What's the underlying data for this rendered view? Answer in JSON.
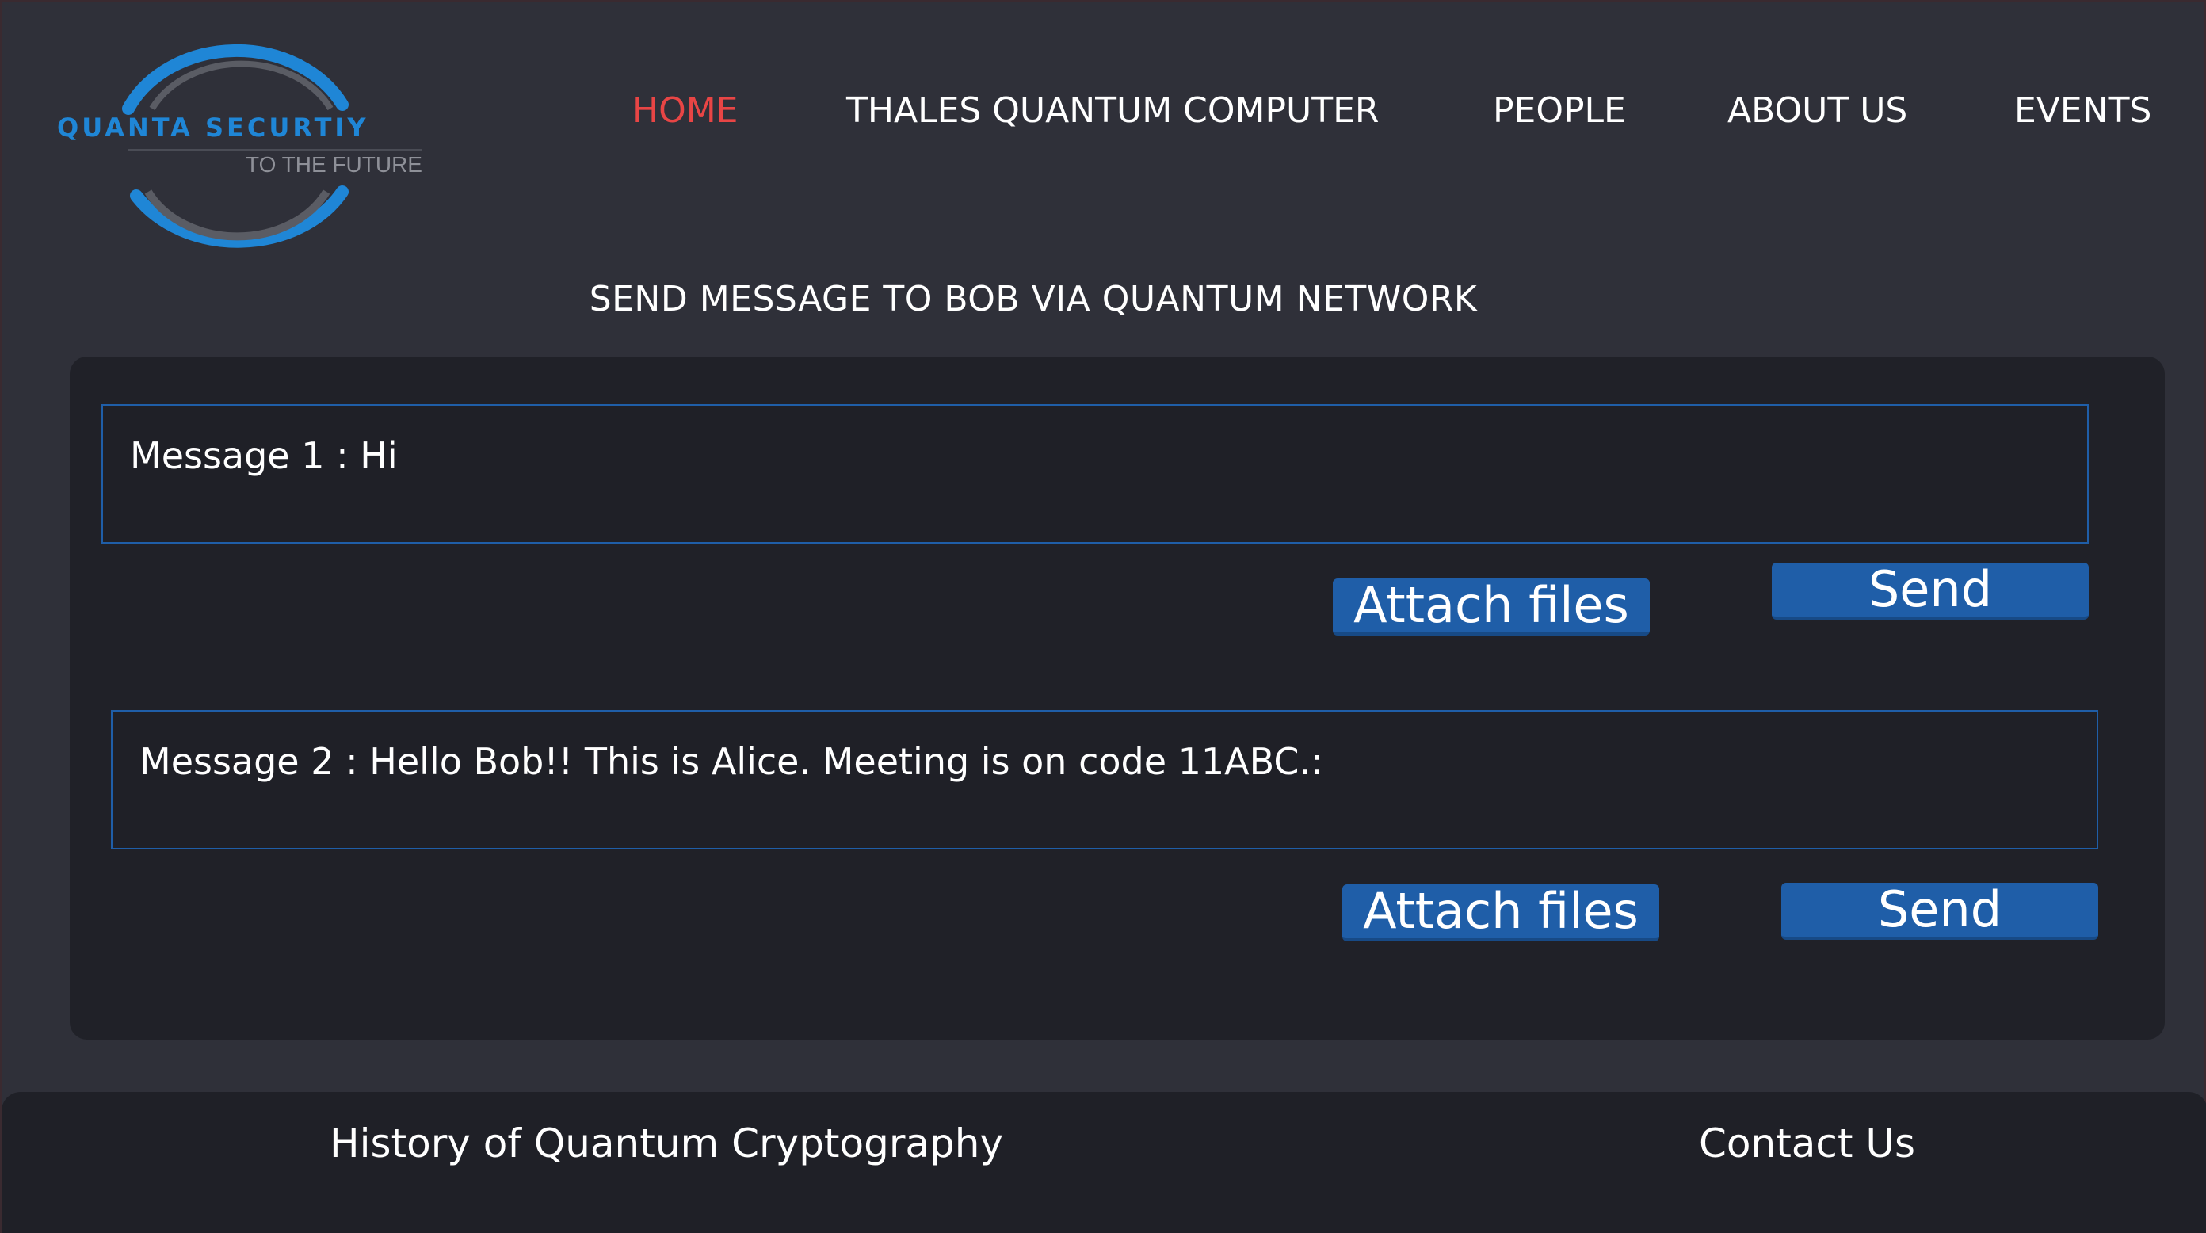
{
  "logo": {
    "title": "QUANTA SECURTIY",
    "tagline": "TO THE FUTURE"
  },
  "nav": {
    "items": [
      {
        "label": "HOME",
        "active": true
      },
      {
        "label": "THALES QUANTUM COMPUTER",
        "active": false
      },
      {
        "label": "PEOPLE",
        "active": false
      },
      {
        "label": "ABOUT US",
        "active": false
      },
      {
        "label": "EVENTS",
        "active": false
      }
    ]
  },
  "main": {
    "title": "SEND MESSAGE TO BOB VIA QUANTUM NETWORK",
    "messages": [
      {
        "text": "Message 1 :  Hi",
        "attach_label": "Attach files",
        "send_label": "Send"
      },
      {
        "text": "Message 2 : Hello Bob!! This is Alice. Meeting is on code 11ABC.:",
        "attach_label": "Attach files",
        "send_label": "Send"
      }
    ]
  },
  "footer": {
    "history_link": "History of Quantum Cryptography",
    "contact_link": "Contact Us"
  },
  "colors": {
    "background": "#2f3039",
    "panel": "#202128",
    "accent": "#1f5ea8",
    "nav_active": "#e84545",
    "logo_blue": "#1f86d6"
  }
}
